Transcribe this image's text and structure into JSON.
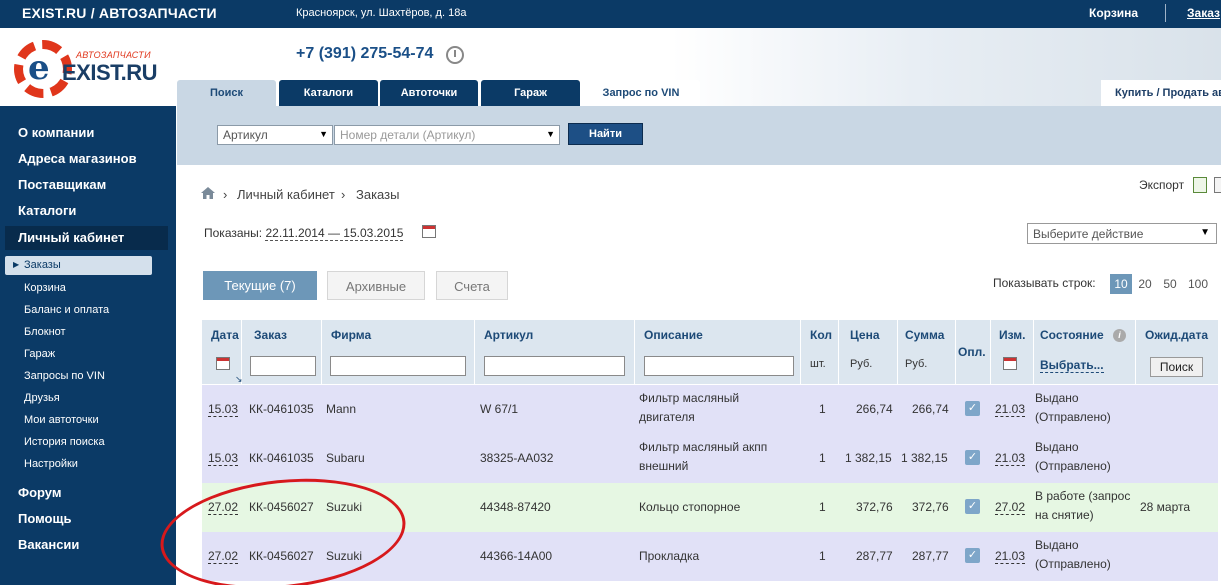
{
  "topbar": {
    "brand": "EXIST.RU / АВТОЗАПЧАСТИ",
    "address": "Красноярск, ул. Шахтёров, д. 18а",
    "cart": "Корзина",
    "orders": "Заказ"
  },
  "header": {
    "logo_sub": "АВТОЗАПЧАСТИ",
    "logo_name": "EXIST.RU",
    "phone": "+7 (391) 275-54-74"
  },
  "tabs": [
    {
      "label": "Поиск"
    },
    {
      "label": "Каталоги"
    },
    {
      "label": "Автоточки"
    },
    {
      "label": "Гараж"
    },
    {
      "label": "Запрос по VIN"
    }
  ],
  "buysell": "Купить / Продать ав",
  "search": {
    "type_value": "Артикул",
    "placeholder": "Номер детали (Артикул)",
    "button": "Найти"
  },
  "sidebar": {
    "main_top": [
      "О компании",
      "Адреса магазинов",
      "Поставщикам",
      "Каталоги"
    ],
    "cabinet": "Личный кабинет",
    "sub_active": "Заказы",
    "sub": [
      "Корзина",
      "Баланс и оплата",
      "Блокнот",
      "Гараж",
      "Запросы по VIN",
      "Друзья",
      "Мои автоточки",
      "История поиска",
      "Настройки"
    ],
    "main_bottom": [
      "Форум",
      "Помощь",
      "Вакансии"
    ]
  },
  "breadcrumb": {
    "item1": "Личный кабинет",
    "item2": "Заказы",
    "sep": "›"
  },
  "export": "Экспорт",
  "shown": {
    "label": "Показаны:",
    "range": "22.11.2014 — 15.03.2015"
  },
  "action_select": "Выберите действие",
  "order_tabs": {
    "current": "Текущие (7)",
    "archive": "Архивные",
    "invoices": "Счета"
  },
  "rows_per_page": {
    "label": "Показывать строк:",
    "options": [
      "10",
      "20",
      "50",
      "100"
    ]
  },
  "table": {
    "headers": {
      "date": "Дата",
      "order": "Заказ",
      "firm": "Фирма",
      "article": "Артикул",
      "description": "Описание",
      "qty": "Кол",
      "qty_unit": "шт.",
      "price": "Цена",
      "price_unit": "Руб.",
      "sum": "Сумма",
      "sum_unit": "Руб.",
      "paid": "Опл.",
      "changed": "Изм.",
      "status": "Состояние",
      "status_choose": "Выбрать...",
      "expected": "Ожид.дата",
      "search_btn": "Поиск"
    },
    "rows": [
      {
        "date": "15.03",
        "order": "КК-0461035",
        "firm": "Mann",
        "article": "W 67/1",
        "desc1": "Фильтр масляный",
        "desc2": "двигателя",
        "qty": "1",
        "price": "266,74",
        "sum": "266,74",
        "changed": "21.03",
        "status1": "Выдано",
        "status2": "(Отправлено)",
        "expected": ""
      },
      {
        "date": "15.03",
        "order": "КК-0461035",
        "firm": "Subaru",
        "article": "38325-AA032",
        "desc1": "Фильтр масляный акпп",
        "desc2": "внешний",
        "qty": "1",
        "price": "1 382,15",
        "sum": "1 382,15",
        "changed": "21.03",
        "status1": "Выдано",
        "status2": "(Отправлено)",
        "expected": ""
      },
      {
        "date": "27.02",
        "order": "КК-0456027",
        "firm": "Suzuki",
        "article": "44348-87420",
        "desc1": "Кольцо стопорное",
        "desc2": "",
        "qty": "1",
        "price": "372,76",
        "sum": "372,76",
        "changed": "27.02",
        "status1": "В работе (запрос",
        "status2": "на снятие)",
        "expected": "28 марта"
      },
      {
        "date": "27.02",
        "order": "КК-0456027",
        "firm": "Suzuki",
        "article": "44366-14A00",
        "desc1": "Прокладка",
        "desc2": "",
        "qty": "1",
        "price": "287,77",
        "sum": "287,77",
        "changed": "21.03",
        "status1": "Выдано",
        "status2": "(Отправлено)",
        "expected": ""
      }
    ]
  },
  "colors": {
    "navy": "#0b3a66",
    "row_blue": "#e1e1f7",
    "row_green": "#e6f7e3",
    "accent_red": "#d7191c"
  }
}
